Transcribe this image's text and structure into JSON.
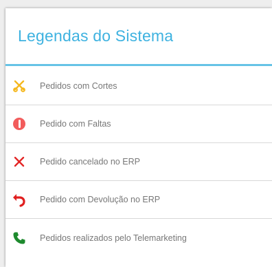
{
  "panel": {
    "title": "Legendas do Sistema"
  },
  "legend": {
    "items": [
      {
        "icon": "scissors-icon",
        "color": "#f5b81e",
        "label": "Pedidos com Cortes"
      },
      {
        "icon": "half-circle-icon",
        "color": "#f25c5c",
        "label": "Pedido com Faltas"
      },
      {
        "icon": "close-x-icon",
        "color": "#e32626",
        "label": "Pedido cancelado no ERP"
      },
      {
        "icon": "undo-arrow-icon",
        "color": "#e01f1f",
        "label": "Pedido com Devolução no ERP"
      },
      {
        "icon": "phone-icon",
        "color": "#1e8a2e",
        "label": "Pedidos realizados pelo Telemarketing"
      }
    ]
  },
  "colors": {
    "accent": "#3eb2e0",
    "header_rule": "#66c3e6"
  }
}
